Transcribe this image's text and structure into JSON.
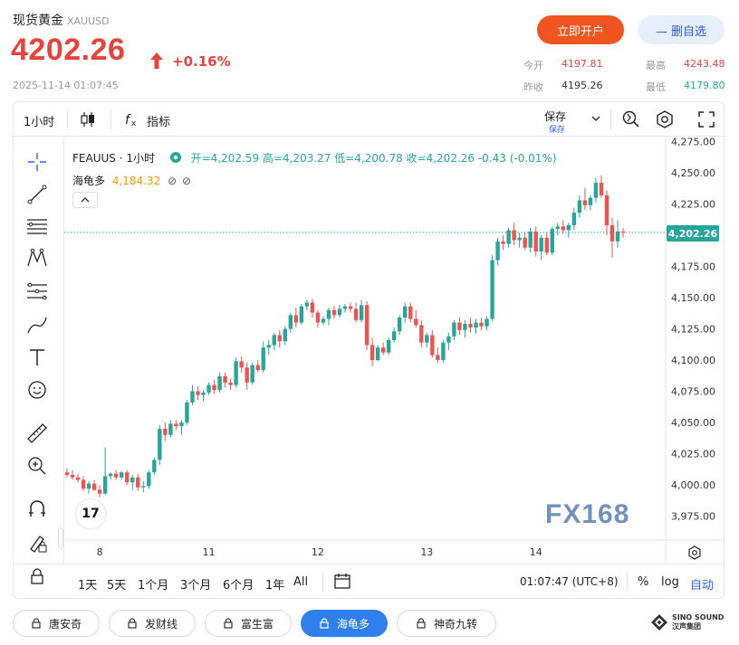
{
  "header": {
    "title": "现货黄金",
    "symbol": "XAUUSD",
    "price": "4202.26",
    "change_pct": "+0.16%",
    "timestamp": "2025-11-14 01:07:45",
    "open_account_label": "立即开户",
    "remove_fav_label": "— 删自选",
    "stats": {
      "open_label": "今开",
      "open_value": "4197.81",
      "high_label": "最高",
      "high_value": "4243.48",
      "prevclose_label": "昨收",
      "prevclose_value": "4195.26",
      "low_label": "最低",
      "low_value": "4179.80"
    },
    "colors": {
      "up": "#e6433b",
      "down_value": "#26a69a",
      "accent": "#f0551f"
    }
  },
  "toolbar": {
    "interval": "1小时",
    "indicators_label": "指标",
    "save_label": "保存",
    "save_sub": "保存"
  },
  "legend": {
    "symbol": "FEAUUS · 1小时",
    "ohlc": "开=4,202.59 高=4,203.27 低=4,200.78 收=4,202.26 -0.43 (-0.01%)",
    "indicator_name": "海龟多",
    "indicator_value": "4,184.32"
  },
  "chart_data": {
    "type": "candlestick",
    "title": "",
    "xlabel": "",
    "ylabel": "",
    "ylim": [
      3950,
      4275
    ],
    "y_ticks": [
      3975,
      4000,
      4025,
      4050,
      4075,
      4100,
      4125,
      4150,
      4175,
      4200,
      4225,
      4250,
      4275
    ],
    "y_tick_labels": [
      "3,975.00",
      "4,000.00",
      "4,025.00",
      "4,050.00",
      "4,075.00",
      "4,100.00",
      "4,125.00",
      "4,150.00",
      "4,175.00",
      "4,200.00",
      "4,225.00",
      "4,250.00",
      "4,275.00"
    ],
    "x_tick_labels": [
      "8",
      "11",
      "12",
      "13",
      "14"
    ],
    "x_tick_index": [
      6,
      26,
      46,
      66,
      86
    ],
    "last_price": 4202.26,
    "last_price_label": "4,202.26",
    "up_color": "#26a69a",
    "down_color": "#ef5350",
    "candles": [
      [
        4010,
        4013,
        4006,
        4008
      ],
      [
        4008,
        4012,
        4004,
        4006
      ],
      [
        4006,
        4009,
        4002,
        4004
      ],
      [
        4004,
        4007,
        3995,
        3997
      ],
      [
        3997,
        4003,
        3993,
        4001
      ],
      [
        4001,
        4004,
        3995,
        3996
      ],
      [
        3996,
        4000,
        3990,
        3993
      ],
      [
        3993,
        4030,
        3992,
        4007
      ],
      [
        4007,
        4010,
        4004,
        4009
      ],
      [
        4009,
        4012,
        4004,
        4006
      ],
      [
        4006,
        4011,
        4004,
        4010
      ],
      [
        4010,
        4012,
        4000,
        4002
      ],
      [
        4002,
        4008,
        3996,
        4006
      ],
      [
        4006,
        4009,
        3995,
        3998
      ],
      [
        3998,
        4003,
        3994,
        3999
      ],
      [
        3999,
        4012,
        3997,
        4010
      ],
      [
        4010,
        4022,
        4008,
        4020
      ],
      [
        4020,
        4048,
        4016,
        4045
      ],
      [
        4045,
        4050,
        4035,
        4040
      ],
      [
        4040,
        4052,
        4038,
        4049
      ],
      [
        4049,
        4052,
        4044,
        4047
      ],
      [
        4047,
        4052,
        4040,
        4050
      ],
      [
        4050,
        4068,
        4048,
        4066
      ],
      [
        4066,
        4080,
        4064,
        4075
      ],
      [
        4075,
        4079,
        4068,
        4072
      ],
      [
        4072,
        4076,
        4067,
        4074
      ],
      [
        4074,
        4082,
        4072,
        4080
      ],
      [
        4080,
        4084,
        4073,
        4076
      ],
      [
        4076,
        4090,
        4074,
        4087
      ],
      [
        4087,
        4090,
        4078,
        4082
      ],
      [
        4082,
        4085,
        4076,
        4080
      ],
      [
        4080,
        4102,
        4078,
        4099
      ],
      [
        4099,
        4103,
        4090,
        4094
      ],
      [
        4094,
        4098,
        4076,
        4082
      ],
      [
        4082,
        4098,
        4080,
        4096
      ],
      [
        4096,
        4100,
        4090,
        4092
      ],
      [
        4092,
        4115,
        4090,
        4110
      ],
      [
        4110,
        4116,
        4104,
        4112
      ],
      [
        4112,
        4122,
        4108,
        4120
      ],
      [
        4120,
        4124,
        4110,
        4115
      ],
      [
        4115,
        4127,
        4112,
        4125
      ],
      [
        4125,
        4138,
        4122,
        4136
      ],
      [
        4136,
        4142,
        4126,
        4130
      ],
      [
        4130,
        4145,
        4128,
        4143
      ],
      [
        4143,
        4148,
        4140,
        4146
      ],
      [
        4146,
        4149,
        4134,
        4138
      ],
      [
        4138,
        4140,
        4126,
        4130
      ],
      [
        4130,
        4135,
        4128,
        4133
      ],
      [
        4133,
        4142,
        4128,
        4140
      ],
      [
        4140,
        4143,
        4133,
        4136
      ],
      [
        4136,
        4144,
        4134,
        4141
      ],
      [
        4141,
        4145,
        4138,
        4143
      ],
      [
        4143,
        4146,
        4138,
        4141
      ],
      [
        4141,
        4146,
        4130,
        4132
      ],
      [
        4132,
        4148,
        4130,
        4144
      ],
      [
        4144,
        4147,
        4108,
        4112
      ],
      [
        4112,
        4118,
        4095,
        4100
      ],
      [
        4100,
        4112,
        4099,
        4110
      ],
      [
        4110,
        4114,
        4104,
        4106
      ],
      [
        4106,
        4118,
        4104,
        4116
      ],
      [
        4116,
        4126,
        4114,
        4123
      ],
      [
        4123,
        4136,
        4120,
        4134
      ],
      [
        4134,
        4146,
        4130,
        4143
      ],
      [
        4143,
        4146,
        4130,
        4133
      ],
      [
        4133,
        4140,
        4126,
        4128
      ],
      [
        4128,
        4132,
        4110,
        4114
      ],
      [
        4114,
        4122,
        4110,
        4120
      ],
      [
        4120,
        4124,
        4102,
        4104
      ],
      [
        4104,
        4110,
        4098,
        4100
      ],
      [
        4100,
        4116,
        4098,
        4114
      ],
      [
        4114,
        4122,
        4108,
        4119
      ],
      [
        4119,
        4132,
        4116,
        4130
      ],
      [
        4130,
        4134,
        4120,
        4124
      ],
      [
        4124,
        4132,
        4118,
        4129
      ],
      [
        4129,
        4134,
        4122,
        4126
      ],
      [
        4126,
        4133,
        4121,
        4130
      ],
      [
        4130,
        4134,
        4124,
        4127
      ],
      [
        4127,
        4135,
        4124,
        4133
      ],
      [
        4133,
        4184,
        4131,
        4180
      ],
      [
        4180,
        4198,
        4176,
        4195
      ],
      [
        4195,
        4200,
        4188,
        4193
      ],
      [
        4193,
        4206,
        4190,
        4204
      ],
      [
        4204,
        4210,
        4192,
        4196
      ],
      [
        4196,
        4202,
        4190,
        4198
      ],
      [
        4198,
        4202,
        4188,
        4190
      ],
      [
        4190,
        4206,
        4186,
        4203
      ],
      [
        4203,
        4207,
        4183,
        4187
      ],
      [
        4187,
        4200,
        4180,
        4198
      ],
      [
        4198,
        4202,
        4184,
        4186
      ],
      [
        4186,
        4207,
        4184,
        4205
      ],
      [
        4205,
        4210,
        4200,
        4207
      ],
      [
        4207,
        4212,
        4201,
        4204
      ],
      [
        4204,
        4210,
        4198,
        4208
      ],
      [
        4208,
        4222,
        4204,
        4218
      ],
      [
        4218,
        4232,
        4214,
        4228
      ],
      [
        4228,
        4238,
        4220,
        4224
      ],
      [
        4224,
        4232,
        4220,
        4230
      ],
      [
        4230,
        4246,
        4226,
        4242
      ],
      [
        4242,
        4248,
        4230,
        4232
      ],
      [
        4232,
        4236,
        4200,
        4208
      ],
      [
        4208,
        4214,
        4182,
        4195
      ],
      [
        4195,
        4212,
        4190,
        4203
      ],
      [
        4203,
        4206,
        4198,
        4202
      ]
    ]
  },
  "time_ranges": [
    "1天",
    "5天",
    "1个月",
    "3个月",
    "6个月",
    "1年",
    "All"
  ],
  "bottom_status": {
    "time": "01:07:47 (UTC+8)",
    "pct_label": "%",
    "log_label": "log",
    "auto_label": "自动"
  },
  "strategy_tags": [
    "唐安奇",
    "发财线",
    "富生富",
    "海龟多",
    "神奇九转"
  ],
  "active_tag_index": 3,
  "watermark": "FX168",
  "corner_logo": "SINO SOUND 汉声集团"
}
